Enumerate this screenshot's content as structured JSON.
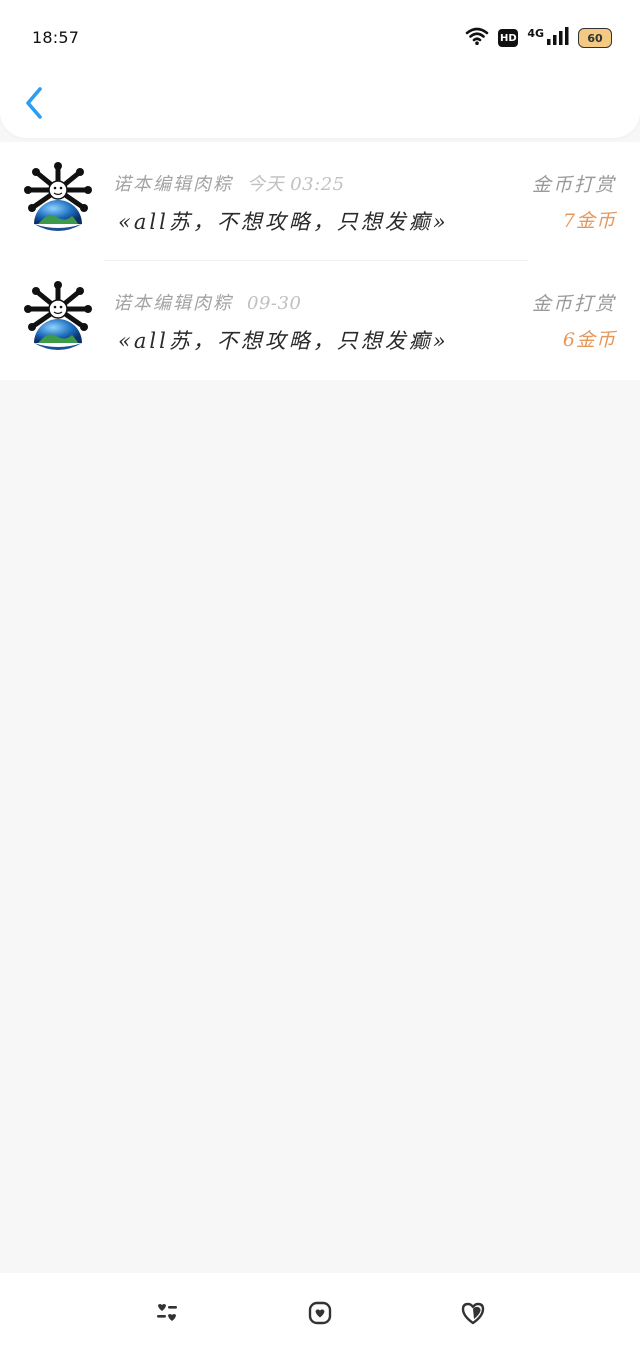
{
  "status_bar": {
    "time": "18:57",
    "hd_label": "HD",
    "network_label": "4G",
    "battery_level": "60"
  },
  "reward_list": [
    {
      "user_name": "诺本编辑肉粽",
      "time": "今天 03:25",
      "book_title": "«all苏，不想攻略，只想发癫»",
      "reward_type": "金币打赏",
      "amount": "7金币"
    },
    {
      "user_name": "诺本编辑肉粽",
      "time": "09-30",
      "book_title": "«all苏，不想攻略，只想发癫»",
      "reward_type": "金币打赏",
      "amount": "6金币"
    }
  ],
  "bottom_nav": {
    "icons": [
      "list-heart-icon",
      "heart-badge-icon",
      "heart-tag-icon"
    ]
  },
  "colors": {
    "accent_blue": "#2a9df4",
    "amount_orange": "#e6985b",
    "page_background": "#f8f7f7"
  }
}
